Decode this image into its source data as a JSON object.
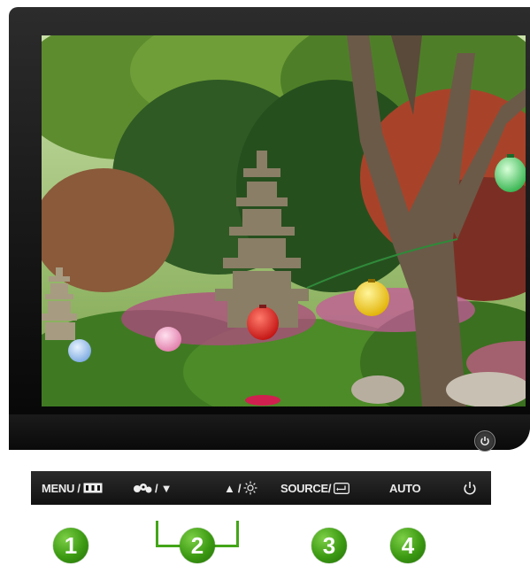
{
  "monitor": {
    "power_led_icon": "power-icon"
  },
  "controls": {
    "menu": {
      "label": "MENU /",
      "icon": "menu-grid-icon"
    },
    "brightness_down": {
      "label": "/ ▼",
      "icon": "magic-bright-icon"
    },
    "brightness_up": {
      "label": "▲ /",
      "icon": "brightness-sun-icon"
    },
    "source": {
      "label": "SOURCE/",
      "icon": "enter-icon"
    },
    "auto": {
      "label": "AUTO"
    },
    "power": {
      "icon": "power-icon"
    }
  },
  "markers": [
    {
      "number": "1"
    },
    {
      "number": "2"
    },
    {
      "number": "3"
    },
    {
      "number": "4"
    }
  ],
  "colors": {
    "marker_green": "#43a518",
    "control_bar": "#1a1a1a",
    "bezel": "#1b1b1b"
  }
}
